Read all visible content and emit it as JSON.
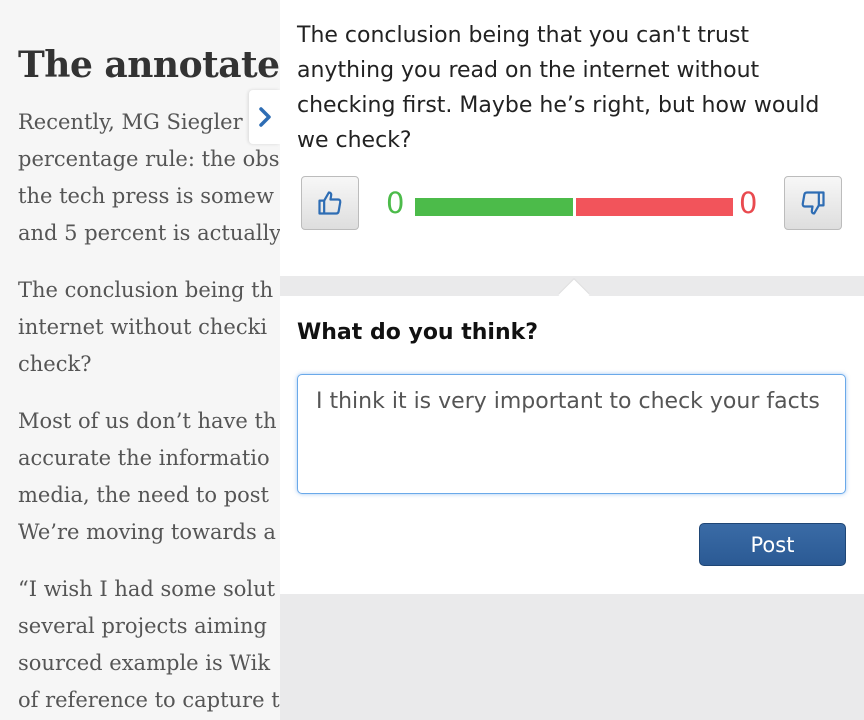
{
  "article": {
    "title": "The annotated",
    "paragraphs": [
      [
        "Recently, MG Siegler",
        "percentage rule: the obs",
        "the tech press is somew",
        "and 5 percent is actually"
      ],
      [
        "The conclusion being th",
        "internet without checki",
        "check?"
      ],
      [
        "Most of us don’t have th",
        "accurate the informatio",
        "media, the need to post",
        "We’re moving towards a"
      ],
      [
        "“I wish I had some solut",
        "several projects aiming",
        "sourced example is Wik",
        "of reference to capture t"
      ]
    ]
  },
  "panel": {
    "quote": "The conclusion being that you can't trust anything you read on the internet without checking first. Maybe he’s right, but how would we check?",
    "votes": {
      "up_count": "0",
      "down_count": "0",
      "agree_fraction": 0.5,
      "up_color": "#4cbb4a",
      "down_color": "#f2545b"
    },
    "comment_heading": "What do you think?",
    "comment_value": "I think it is very important to check your facts",
    "post_label": "Post"
  }
}
